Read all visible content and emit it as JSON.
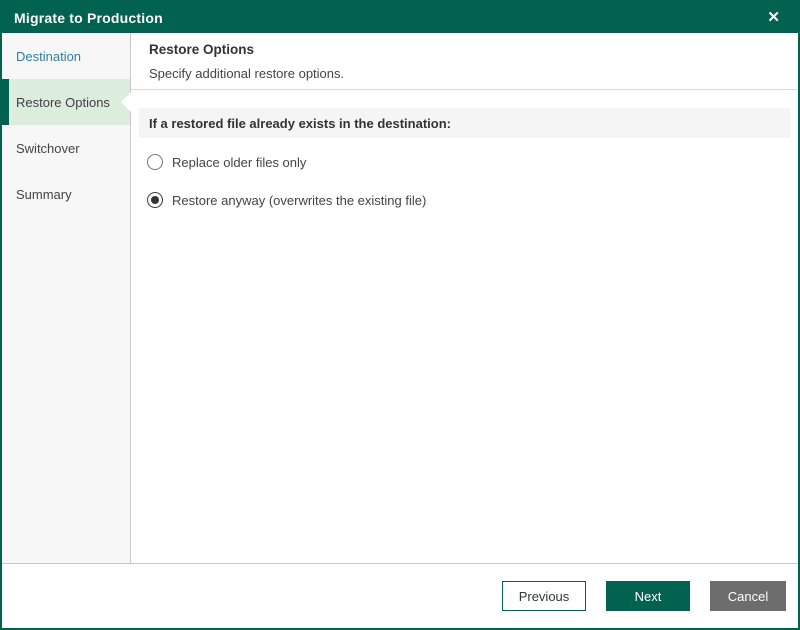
{
  "window": {
    "title": "Migrate to Production",
    "close_icon": "✕"
  },
  "sidebar": {
    "items": [
      {
        "label": "Destination",
        "state": "completed"
      },
      {
        "label": "Restore Options",
        "state": "active"
      },
      {
        "label": "Switchover",
        "state": "upcoming"
      },
      {
        "label": "Summary",
        "state": "upcoming"
      }
    ]
  },
  "header": {
    "title": "Restore Options",
    "subtitle": "Specify additional restore options."
  },
  "content": {
    "section_header": "If a restored file already exists in the destination:",
    "options": [
      {
        "label": "Replace older files only",
        "selected": false
      },
      {
        "label": "Restore anyway (overwrites the existing file)",
        "selected": true
      }
    ]
  },
  "footer": {
    "previous_label": "Previous",
    "next_label": "Next",
    "cancel_label": "Cancel"
  },
  "colors": {
    "brand_green": "#00624f",
    "active_step_bg": "#dcedde",
    "completed_step_text": "#2f7fa6",
    "cancel_gray": "#6d6d6d",
    "section_strip_bg": "#f5f5f5"
  }
}
